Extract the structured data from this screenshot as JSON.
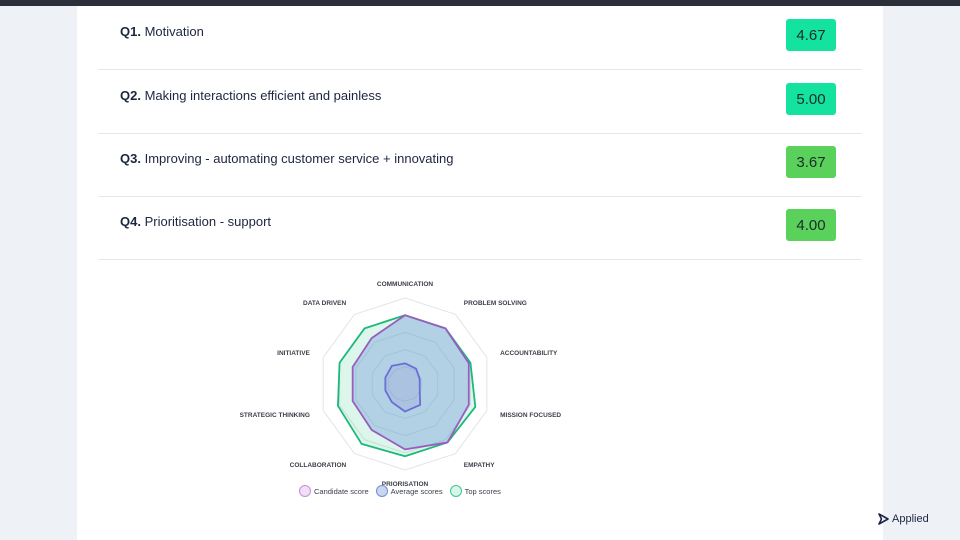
{
  "questions": [
    {
      "number": "Q1.",
      "text": "Motivation",
      "score": "4.67",
      "color": "#14e3a0"
    },
    {
      "number": "Q2.",
      "text": "Making interactions efficient and painless",
      "score": "5.00",
      "color": "#14e3a0"
    },
    {
      "number": "Q3.",
      "text": "Improving - automating customer service + innovating",
      "score": "3.67",
      "color": "#5ad15b"
    },
    {
      "number": "Q4.",
      "text": "Prioritisation - support",
      "score": "4.00",
      "color": "#5ad15b"
    }
  ],
  "chart_data": {
    "type": "radar",
    "axes": [
      "COMMUNICATION",
      "PROBLEM SOLVING",
      "ACCOUNTABILITY",
      "MISSION FOCUSED",
      "EMPATHY",
      "PRIORISATION",
      "COLLABORATION",
      "STRATEGIC THINKING",
      "INITIATIVE",
      "DATA DRIVEN"
    ],
    "rmax": 5,
    "series": [
      {
        "name": "Candidate score",
        "values": [
          1.2,
          1.1,
          0.9,
          0.9,
          1.5,
          1.6,
          1.3,
          1.2,
          1.2,
          1.3
        ],
        "color": "#6a6fd8"
      },
      {
        "name": "Average scores",
        "values": [
          4.0,
          4.0,
          3.9,
          3.9,
          4.2,
          3.8,
          3.3,
          3.2,
          3.2,
          3.3
        ],
        "color": "#9a5cc0"
      },
      {
        "name": "Top scores",
        "values": [
          4.0,
          4.0,
          4.0,
          4.3,
          4.2,
          4.2,
          4.3,
          4.1,
          4.0,
          4.0
        ],
        "color": "#1db87a"
      }
    ]
  },
  "legend": {
    "candidate": {
      "label": "Candidate score",
      "color": "#d7a8e4"
    },
    "average": {
      "label": "Average scores",
      "color": "#9cb3e2"
    },
    "top": {
      "label": "Top scores",
      "color": "#a8edd2"
    }
  },
  "brand": {
    "label": "Applied"
  }
}
